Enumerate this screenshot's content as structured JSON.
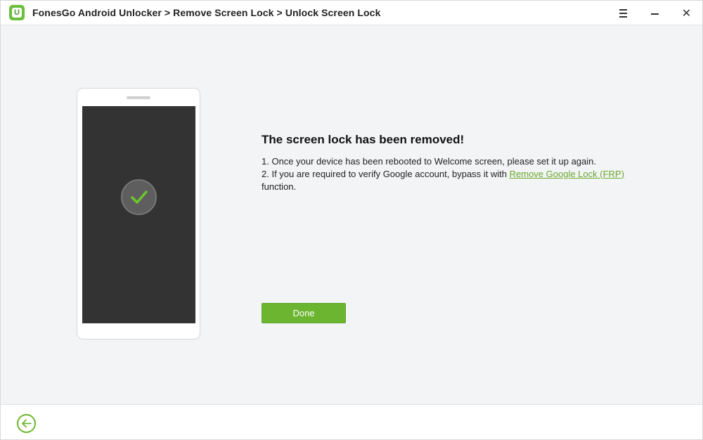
{
  "window": {
    "title": "FonesGo Android Unlocker > Remove Screen Lock > Unlock Screen Lock",
    "logo_letter": "U",
    "controls": [
      "menu-icon",
      "minimize-icon",
      "close-icon"
    ],
    "close_glyph": "✕"
  },
  "main": {
    "heading": "The screen lock has been removed!",
    "step1": "1. Once your device has been rebooted to Welcome screen, please set it up again.",
    "step2_prefix": "2. If you are required to verify Google account, bypass it with ",
    "step2_link": "Remove Google Lock (FRP)",
    "step2_suffix": " function.",
    "done_label": "Done"
  },
  "phone": {
    "status_icon": "checkmark-icon"
  },
  "footer": {
    "back_icon": "back-arrow-icon"
  },
  "colors": {
    "accent": "#6cb530",
    "link": "#6aa92c",
    "phone_screen": "#333333",
    "background": "#f3f4f6"
  }
}
